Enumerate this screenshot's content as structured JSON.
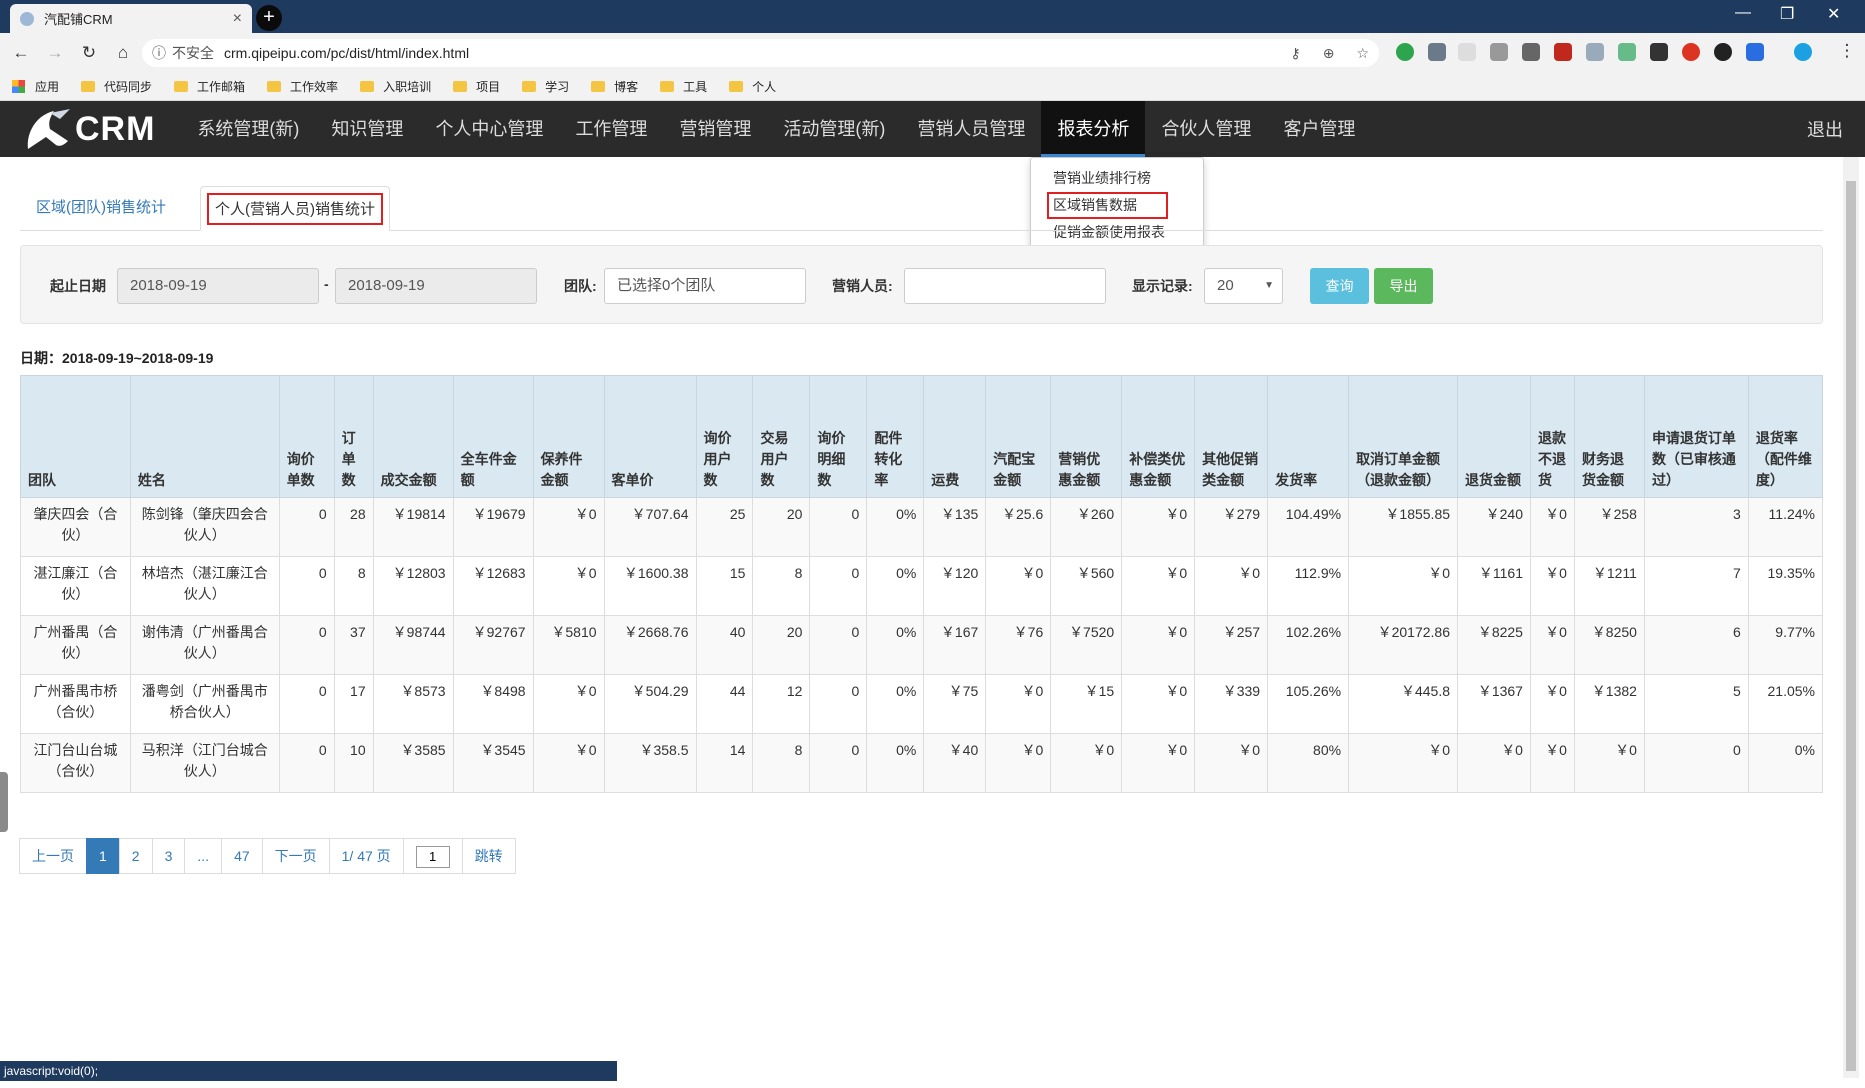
{
  "browser": {
    "tab_title": "汽配铺CRM",
    "url_security": "不安全",
    "url": "crm.qipeipu.com/pc/dist/html/index.html"
  },
  "bookmarks": [
    "应用",
    "代码同步",
    "工作邮箱",
    "工作效率",
    "入职培训",
    "项目",
    "学习",
    "博客",
    "工具",
    "个人"
  ],
  "app": {
    "logo": "CRM",
    "nav": [
      "系统管理(新)",
      "知识管理",
      "个人中心管理",
      "工作管理",
      "营销管理",
      "活动管理(新)",
      "营销人员管理",
      "报表分析",
      "合伙人管理",
      "客户管理"
    ],
    "logout": "退出"
  },
  "dropdown": [
    "营销业绩排行榜",
    "区域销售数据",
    "促销金额使用报表"
  ],
  "tabs": [
    "区域(团队)销售统计",
    "个人(营销人员)销售统计"
  ],
  "filter": {
    "date_label": "起止日期",
    "date_from": "2018-09-19",
    "date_sep": "-",
    "date_to": "2018-09-19",
    "team_label": "团队:",
    "team_value": "已选择0个团队",
    "sales_label": "营销人员:",
    "sales_value": "",
    "records_label": "显示记录:",
    "records_value": "20",
    "query": "查询",
    "export": "导出"
  },
  "date_header": "日期：2018-09-19~2018-09-19",
  "table": {
    "headers": [
      "团队",
      "姓名",
      "询价单数",
      "订单数",
      "成交金额",
      "全车件金额",
      "保养件金额",
      "客单价",
      "询价用户数",
      "交易用户数",
      "询价明细数",
      "配件转化率",
      "运费",
      "汽配宝金额",
      "营销优惠金额",
      "补偿类优惠金额",
      "其他促销类金额",
      "发货率",
      "取消订单金额（退款金额）",
      "退货金额",
      "退款不退货",
      "财务退货金额",
      "申请退货订单数（已审核通过）",
      "退货率（配件维度）"
    ],
    "rows": [
      [
        "肇庆四会（合伙）",
        "陈剑锋（肇庆四会合伙人）",
        "0",
        "28",
        "￥19814",
        "￥19679",
        "￥0",
        "￥707.64",
        "25",
        "20",
        "0",
        "0%",
        "￥135",
        "￥25.6",
        "￥260",
        "￥0",
        "￥279",
        "104.49%",
        "￥1855.85",
        "￥240",
        "￥0",
        "￥258",
        "3",
        "11.24%"
      ],
      [
        "湛江廉江（合伙）",
        "林培杰（湛江廉江合伙人）",
        "0",
        "8",
        "￥12803",
        "￥12683",
        "￥0",
        "￥1600.38",
        "15",
        "8",
        "0",
        "0%",
        "￥120",
        "￥0",
        "￥560",
        "￥0",
        "￥0",
        "112.9%",
        "￥0",
        "￥1161",
        "￥0",
        "￥1211",
        "7",
        "19.35%"
      ],
      [
        "广州番禺（合伙）",
        "谢伟清（广州番禺合伙人）",
        "0",
        "37",
        "￥98744",
        "￥92767",
        "￥5810",
        "￥2668.76",
        "40",
        "20",
        "0",
        "0%",
        "￥167",
        "￥76",
        "￥7520",
        "￥0",
        "￥257",
        "102.26%",
        "￥20172.86",
        "￥8225",
        "￥0",
        "￥8250",
        "6",
        "9.77%"
      ],
      [
        "广州番禺市桥（合伙）",
        "潘粤剑（广州番禺市桥合伙人）",
        "0",
        "17",
        "￥8573",
        "￥8498",
        "￥0",
        "￥504.29",
        "44",
        "12",
        "0",
        "0%",
        "￥75",
        "￥0",
        "￥15",
        "￥0",
        "￥339",
        "105.26%",
        "￥445.8",
        "￥1367",
        "￥0",
        "￥1382",
        "5",
        "21.05%"
      ],
      [
        "江门台山台城（合伙）",
        "马积洋（江门台城合伙人）",
        "0",
        "10",
        "￥3585",
        "￥3545",
        "￥0",
        "￥358.5",
        "14",
        "8",
        "0",
        "0%",
        "￥40",
        "￥0",
        "￥0",
        "￥0",
        "￥0",
        "80%",
        "￥0",
        "￥0",
        "￥0",
        "￥0",
        "0",
        "0%"
      ]
    ]
  },
  "pager": {
    "prev": "上一页",
    "pages": [
      "1",
      "2",
      "3",
      "...",
      "47"
    ],
    "next": "下一页",
    "info": "1/ 47 页",
    "input": "1",
    "jump": "跳转"
  },
  "status_bar": "javascript:void(0);",
  "colors": {
    "nav_bg": "#2b2b2b",
    "header_bg": "#d9e8f1",
    "accent": "#337ab7",
    "query_btn": "#5bc0de",
    "export_btn": "#5cb85c",
    "highlight": "#e02020"
  }
}
